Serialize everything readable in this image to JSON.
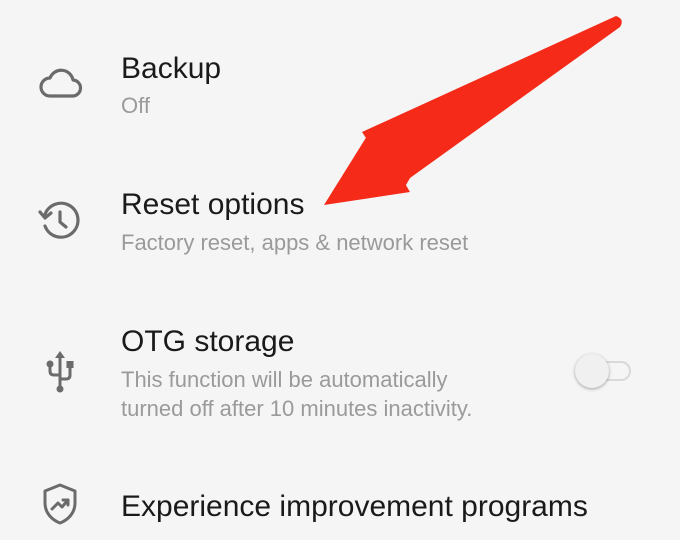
{
  "settings": {
    "items": [
      {
        "title": "Backup",
        "subtitle": "Off",
        "icon": "cloud-icon"
      },
      {
        "title": "Reset options",
        "subtitle": "Factory reset, apps & network reset",
        "icon": "history-icon"
      },
      {
        "title": "OTG storage",
        "subtitle_line1": "This function will be automatically",
        "subtitle_line2": "turned off after 10 minutes inactivity.",
        "icon": "usb-icon",
        "toggle": "off"
      },
      {
        "title": "Experience improvement programs",
        "icon": "shield-trend-icon"
      }
    ]
  },
  "annotation": {
    "icon": "red-arrow",
    "color": "#f52a18"
  },
  "colors": {
    "background": "#f5f5f5",
    "title": "#1a1a1a",
    "subtitle": "#9a9a9a",
    "icon": "#6b6b6b"
  }
}
